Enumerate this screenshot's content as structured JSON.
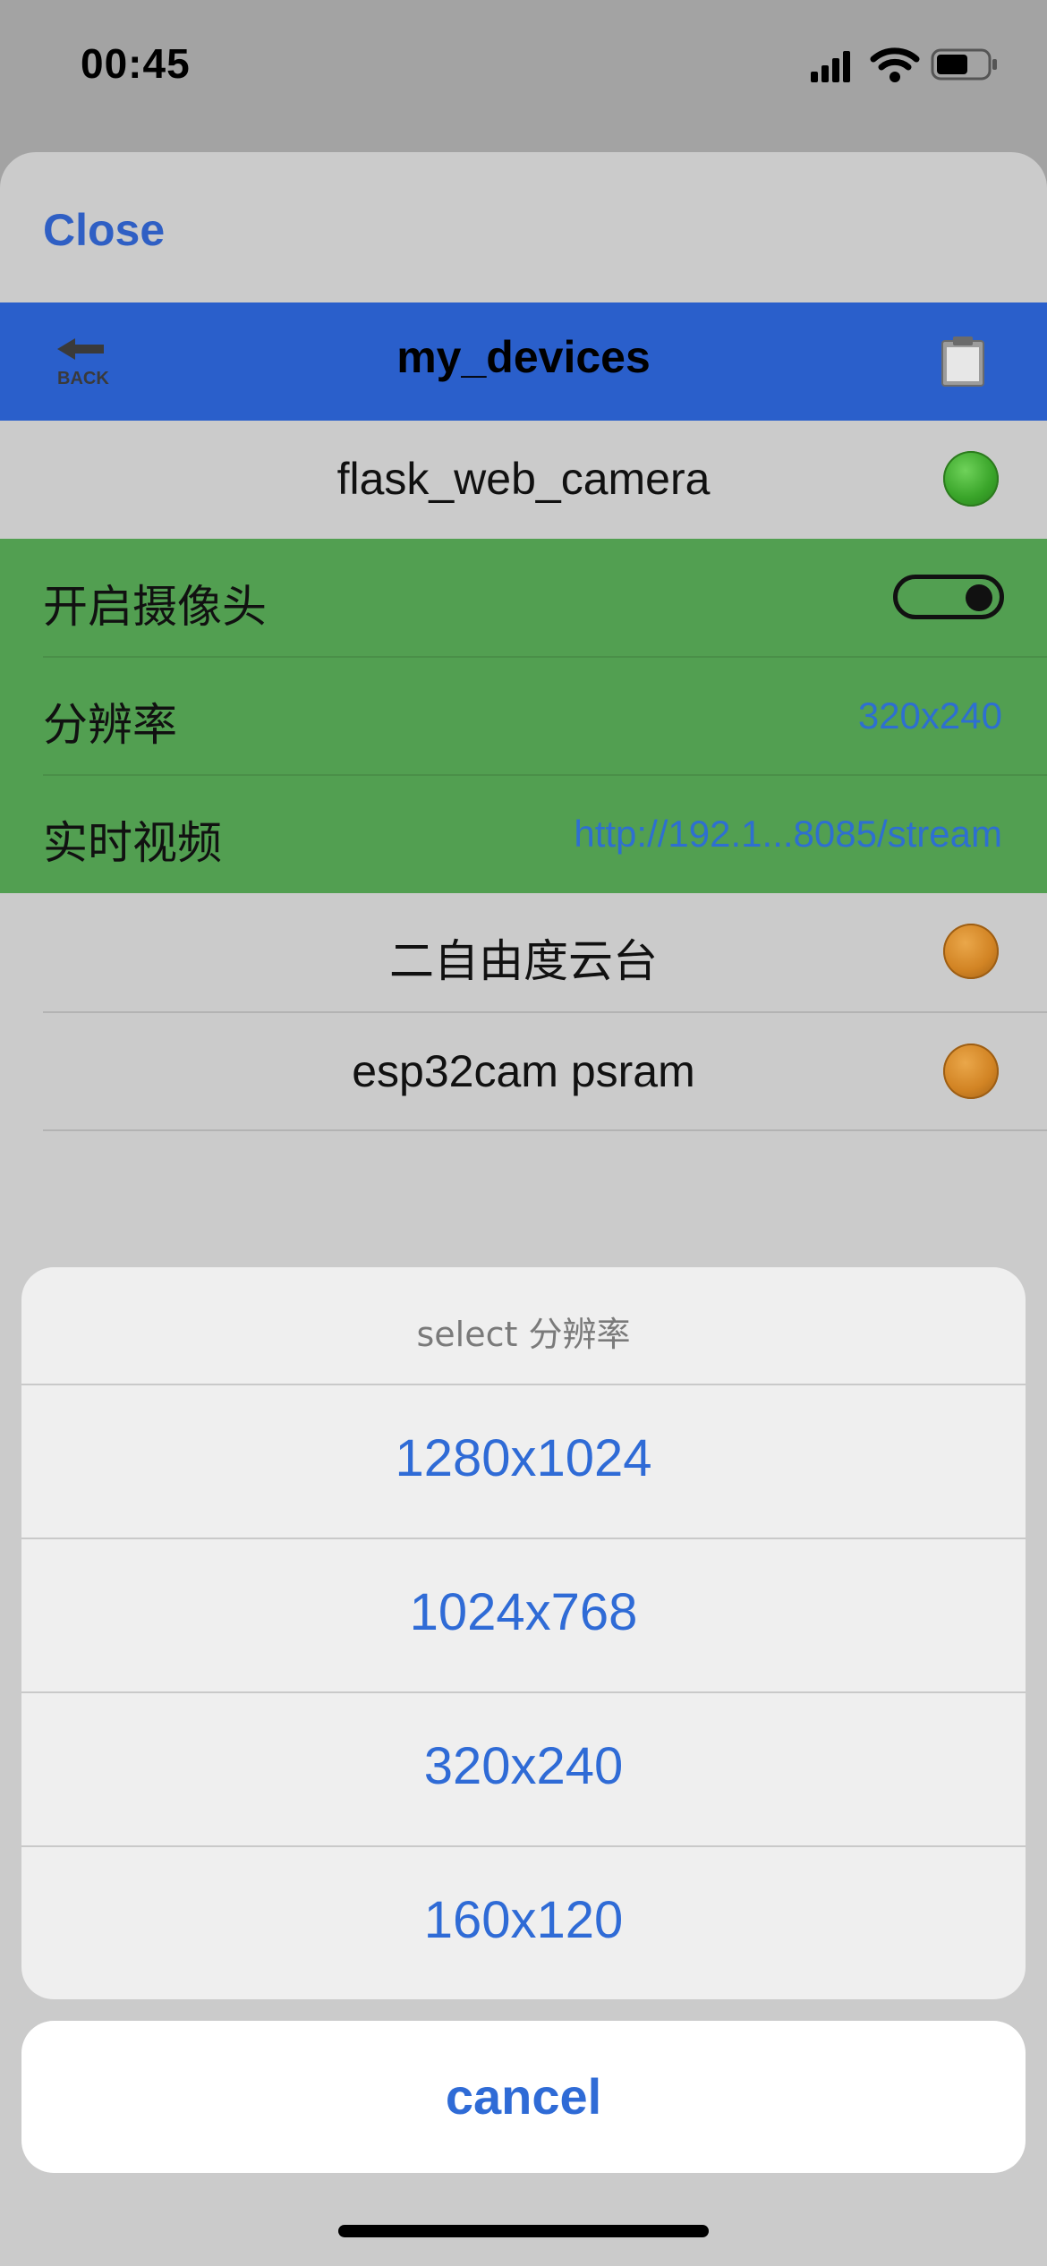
{
  "status_bar": {
    "time": "00:45"
  },
  "sheet": {
    "close_label": "Close"
  },
  "navbar": {
    "back_label": "BACK",
    "title": "my_devices"
  },
  "devices": [
    {
      "name": "flask_web_camera",
      "status_color": "#3aa52a"
    },
    {
      "name": "二自由度云台",
      "status_color": "#d28424"
    },
    {
      "name": "esp32cam psram",
      "status_color": "#d28424"
    }
  ],
  "expanded_device": {
    "rows": [
      {
        "label": "开启摄像头",
        "toggle_on": true
      },
      {
        "label": "分辨率",
        "value": "320x240"
      },
      {
        "label": "实时视频",
        "value": "http://192.1...8085/stream"
      }
    ]
  },
  "action_sheet": {
    "title": "select 分辨率",
    "options": [
      "1280x1024",
      "1024x768",
      "320x240",
      "160x120"
    ],
    "cancel_label": "cancel"
  },
  "colors": {
    "nav_bar": "#2a5fcb",
    "expanded_panel": "#529f51",
    "accent_blue": "#2f6bd6",
    "online_dot": "#3aa52a",
    "offline_dot": "#d28424"
  }
}
